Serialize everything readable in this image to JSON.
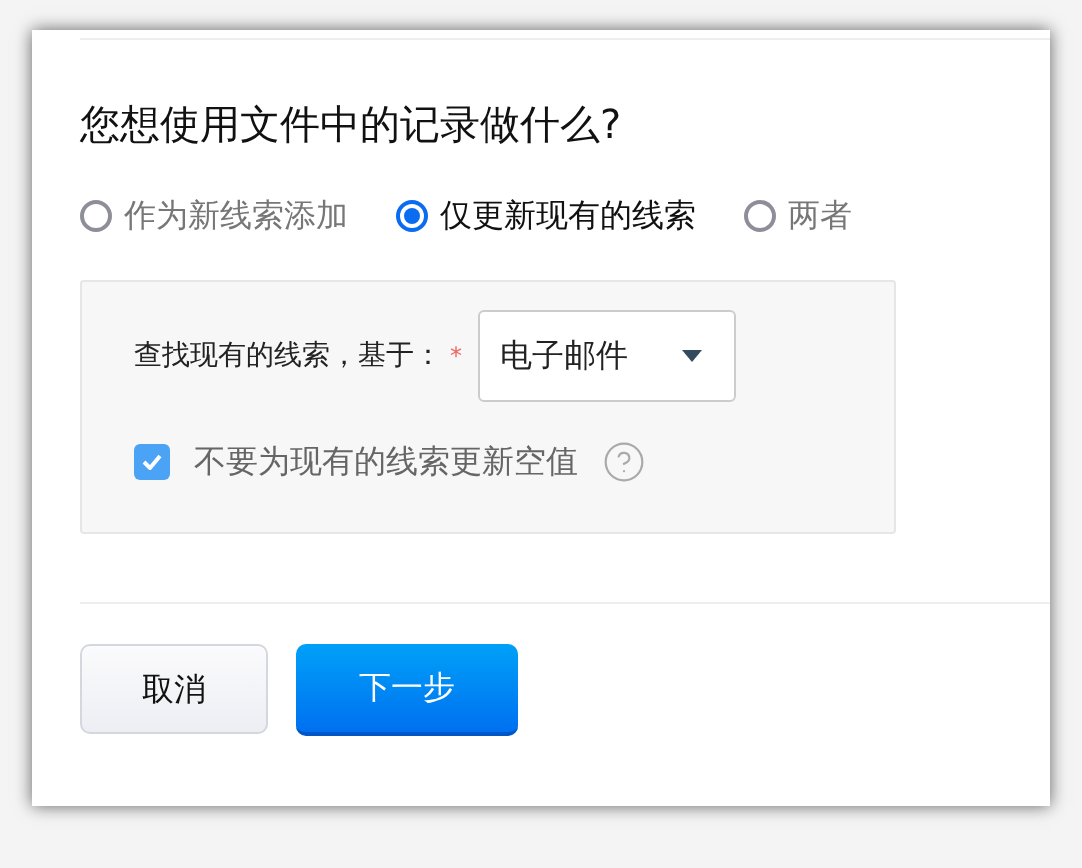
{
  "title": "您想使用文件中的记录做什么?",
  "options": [
    {
      "label": "作为新线索添加",
      "selected": false
    },
    {
      "label": "仅更新现有的线索",
      "selected": true
    },
    {
      "label": "两者",
      "selected": false
    }
  ],
  "match": {
    "label": "查找现有的线索，基于：",
    "required_mark": "*",
    "value": "电子邮件"
  },
  "skip_blank": {
    "label": "不要为现有的线索更新空值",
    "checked": true
  },
  "buttons": [
    {
      "label": "取消",
      "kind": "secondary"
    },
    {
      "label": "下一步",
      "kind": "primary"
    }
  ]
}
